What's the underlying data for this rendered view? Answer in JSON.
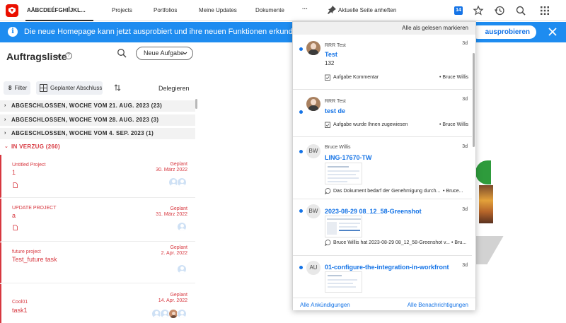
{
  "nav": {
    "items": [
      "AÄBCDEÉFGHIÎJKL...",
      "Projects",
      "Portfolios",
      "Meine Updates",
      "Dokumente"
    ],
    "more": "···",
    "pin_label": "Aktuelle Seite anheften",
    "badge_count": "14",
    "icons": [
      "star-icon",
      "history-icon",
      "search-icon",
      "apps-grid-icon"
    ],
    "logo_color": "#eb1000"
  },
  "banner": {
    "info": "i",
    "text": "Die neue Homepage kann jetzt ausprobiert und ihre neuen Funktionen erkundet werden",
    "button": "ausprobieren",
    "bg_color": "#1e8cf0"
  },
  "worklist": {
    "title": "Auftragsliste",
    "help": "?",
    "new_task": "Neue Aufgabe",
    "filter_count": "8",
    "filter_label": "Filter",
    "planned_label": "Geplanter Abschluss",
    "delegate_label": "Delegieren",
    "groups": [
      {
        "label": "ABGESCHLOSSEN, WOCHE VOM 21. AUG. 2023 (23)",
        "caret": "›"
      },
      {
        "label": "ABGESCHLOSSEN, WOCHE VOM 28. AUG. 2023 (3)",
        "caret": "›"
      },
      {
        "label": "ABGESCHLOSSEN, WOCHE VOM 4. SEP. 2023 (1)",
        "caret": "›"
      },
      {
        "label": "IN VERZUG (260)",
        "caret": "⌄"
      }
    ],
    "tasks": [
      {
        "project": "Untitled Project",
        "name": "1",
        "status": "Geplant",
        "date": "30. März 2022"
      },
      {
        "project": "UPDATE PROJECT",
        "name": "a",
        "status": "Geplant",
        "date": "31. März 2022"
      },
      {
        "project": "future project",
        "name": "Test_future task",
        "status": "Geplant",
        "date": "2. Apr. 2022"
      },
      {
        "project": "Cool01",
        "name": "task1",
        "status": "Geplant",
        "date": "14. Apr. 2022"
      }
    ],
    "overdue_color": "#d7373f"
  },
  "notifications": {
    "mark_all": "Alle als gelesen markieren",
    "items": [
      {
        "author": "RRR Test",
        "time": "3d",
        "title": "Test",
        "body": "132",
        "action": "Aufgabe Kommentar",
        "user": "• Bruce Willis",
        "avatar": ""
      },
      {
        "author": "RRR Test",
        "time": "3d",
        "title": "test de",
        "body": "",
        "action": "Aufgabe wurde Ihnen zugewiesen",
        "user": "• Bruce Willis",
        "avatar": ""
      },
      {
        "author": "Bruce Willis",
        "time": "3d",
        "title": "LING-17670-TW",
        "body": "",
        "action": "Das Dokument bedarf der Genehmigung durch...",
        "user": "• Bruce...",
        "avatar": "BW"
      },
      {
        "author": "",
        "time": "3d",
        "title": "2023-08-29 08_12_58-Greenshot",
        "body": "",
        "action": "Bruce Willis hat 2023-08-29 08_12_58-Greenshot v...",
        "user": "• Bru...",
        "avatar": "BW"
      },
      {
        "author": "",
        "time": "3d",
        "title": "01-configure-the-integration-in-workfront",
        "body": "",
        "action": "",
        "user": "",
        "avatar": "AU"
      }
    ],
    "footer_left": "Alle Ankündigungen",
    "footer_right": "Alle Benachrichtigungen",
    "link_color": "#1473e6"
  }
}
